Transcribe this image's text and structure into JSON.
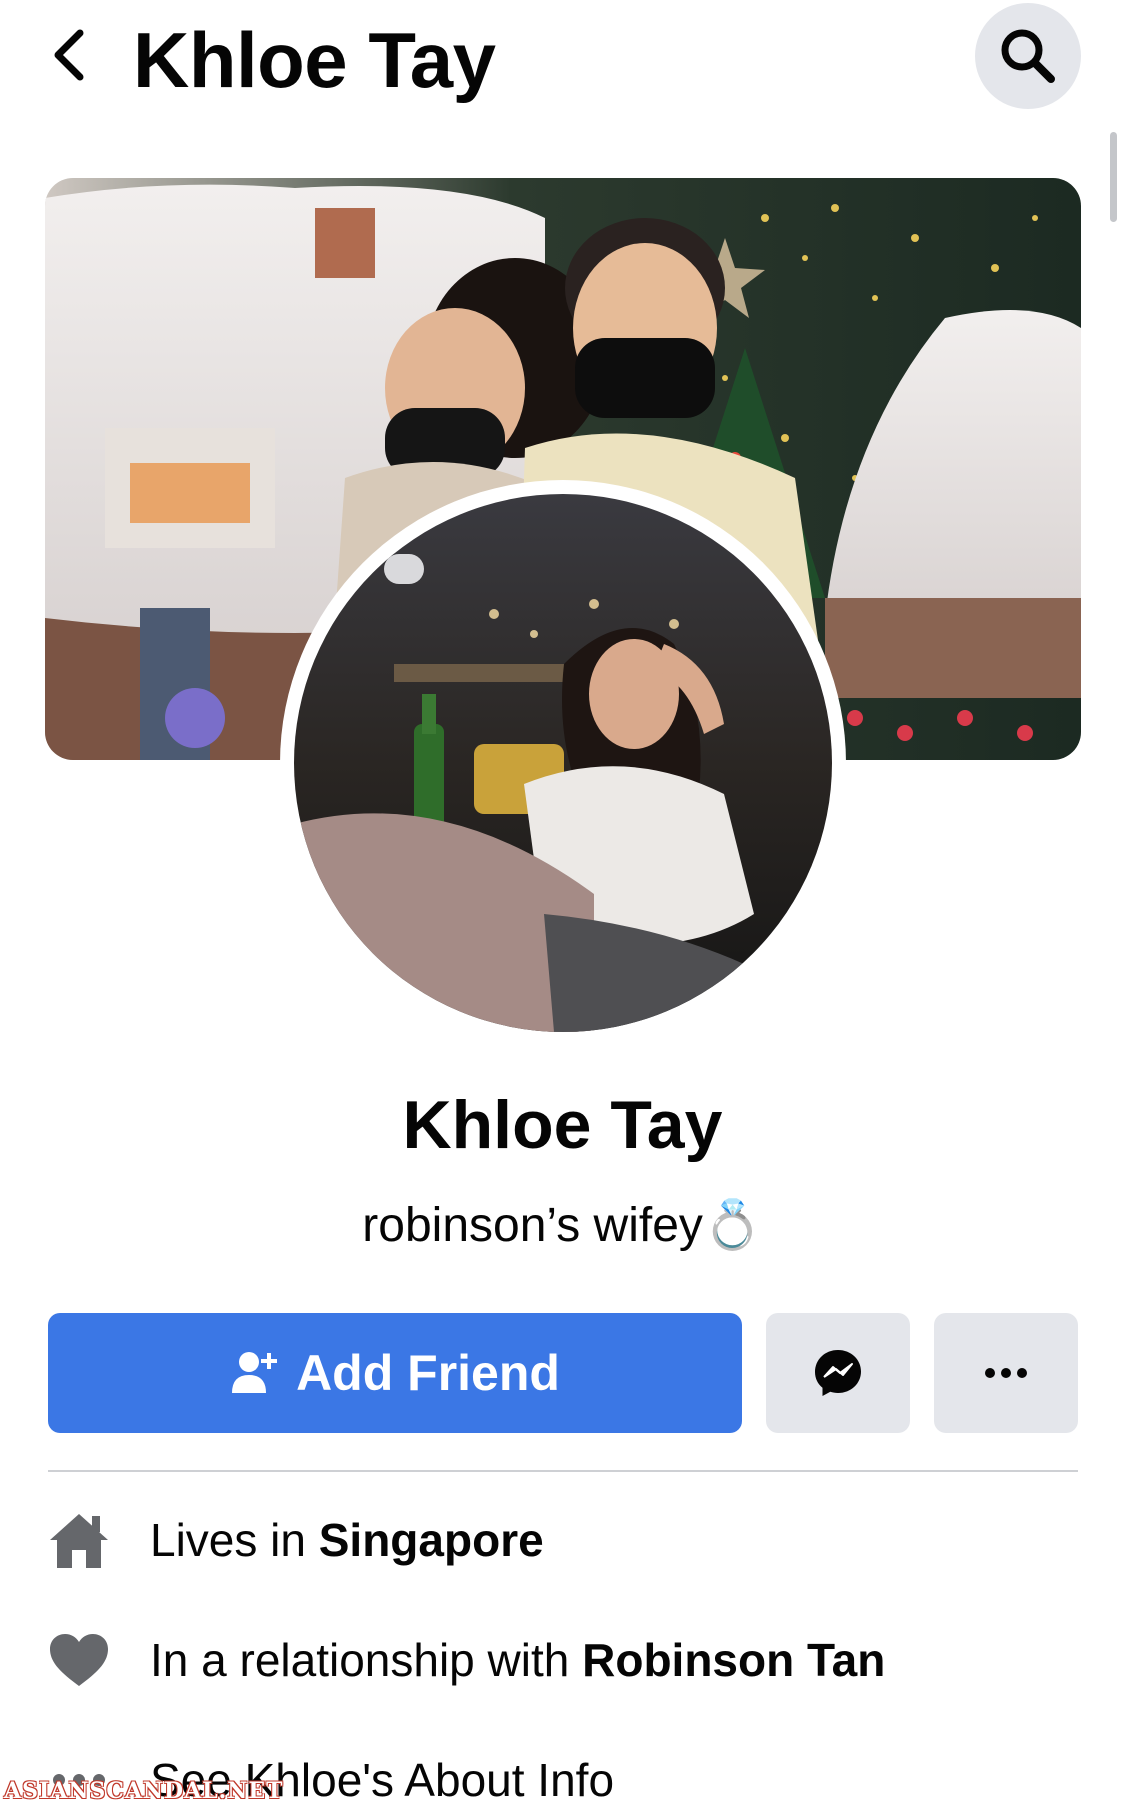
{
  "header": {
    "title": "Khloe Tay",
    "back_icon": "chevron-left-icon",
    "search_icon": "search-icon"
  },
  "profile": {
    "name": "Khloe Tay",
    "bio": "robinson’s wifey💍"
  },
  "actions": {
    "add_friend_label": "Add Friend",
    "add_friend_icon": "add-person-icon",
    "messenger_icon": "messenger-icon",
    "more_icon": "more-horizontal-icon"
  },
  "info": {
    "lives": {
      "prefix": "Lives in ",
      "value": "Singapore",
      "icon": "home-icon"
    },
    "relationship": {
      "prefix": "In a relationship with ",
      "value": "Robinson Tan",
      "icon": "heart-icon"
    },
    "about": {
      "label": "See Khloe's About Info",
      "icon": "ellipsis-icon"
    }
  },
  "watermark": "ASIANSCANDAL.NET",
  "colors": {
    "accent": "#3b77e5",
    "button_gray": "#e4e6eb",
    "icon_gray": "#65676b",
    "divider": "#ced0d4"
  }
}
